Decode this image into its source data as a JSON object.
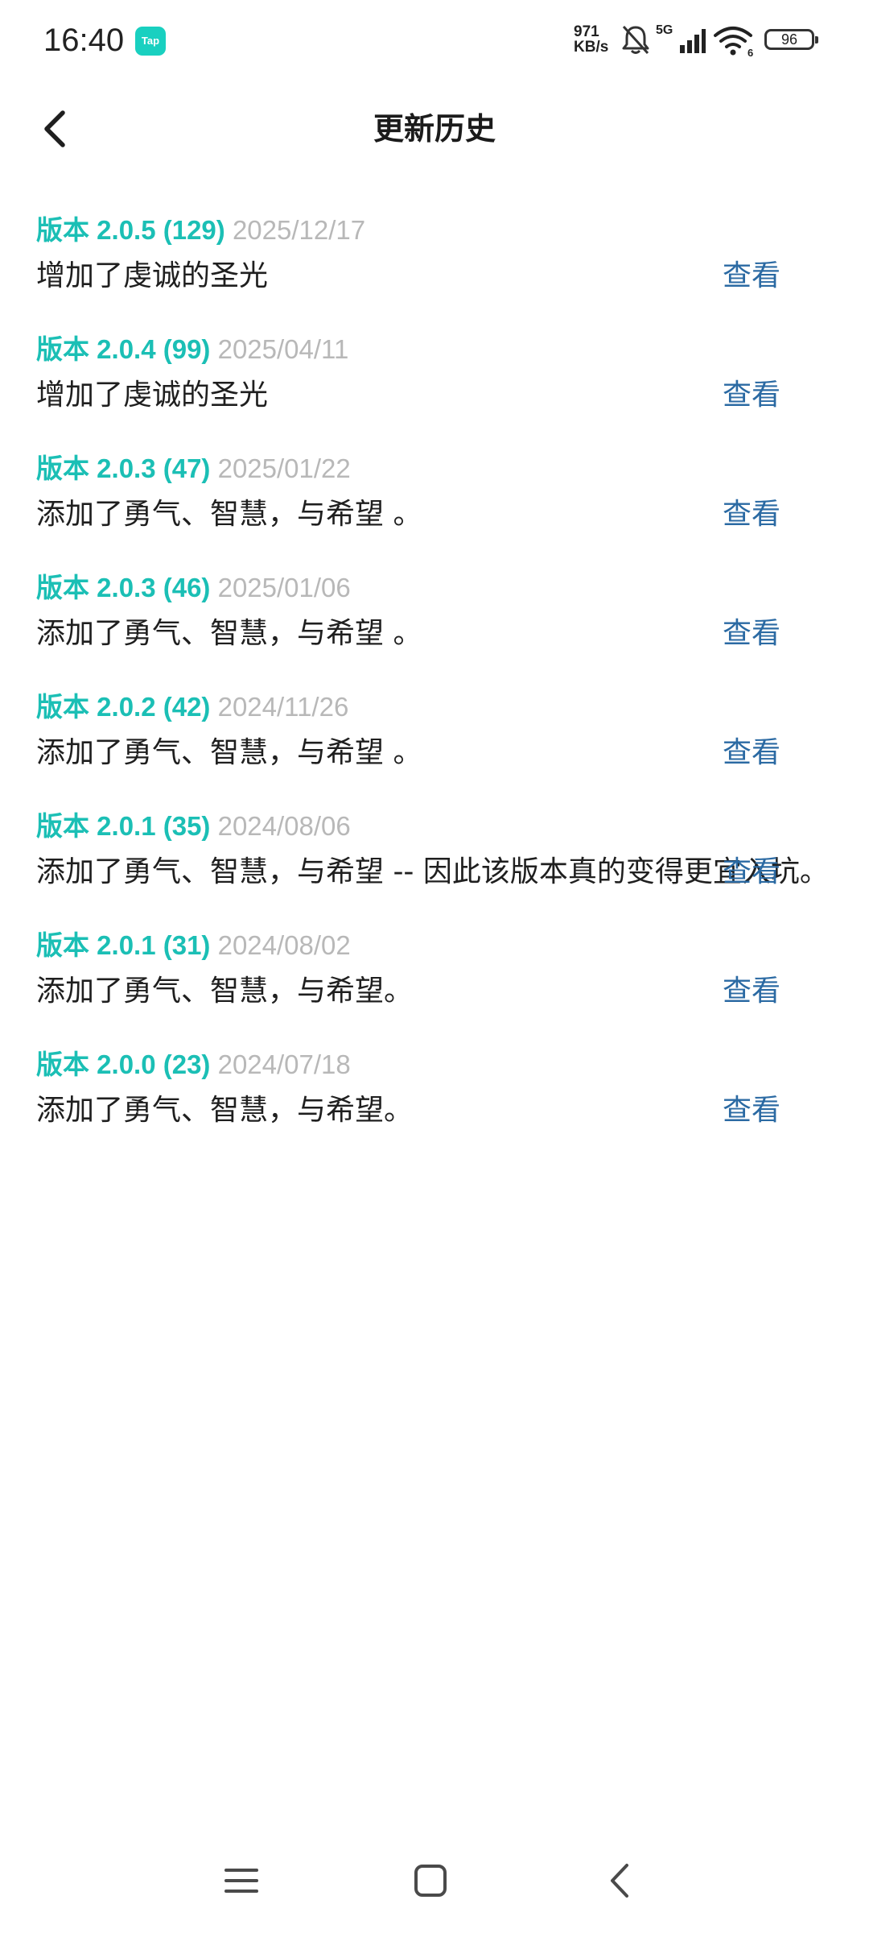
{
  "status_bar": {
    "time": "16:40",
    "app_badge": "Tap",
    "net_speed_value": "971",
    "net_speed_unit": "KB/s",
    "signal_label": "5G",
    "wifi_label": "6",
    "battery": "96"
  },
  "header": {
    "title": "更新历史"
  },
  "view_label": "查看",
  "entries": [
    {
      "version": "版本 2.0.5 (129)",
      "date": "2025/12/17",
      "text": "增加了虔诚的圣光"
    },
    {
      "version": "版本 2.0.4 (99)",
      "date": "2025/04/11",
      "text": "增加了虔诚的圣光"
    },
    {
      "version": "版本 2.0.3 (47)",
      "date": "2025/01/22",
      "text": "添加了勇气、智慧，与希望 。"
    },
    {
      "version": "版本 2.0.3 (46)",
      "date": "2025/01/06",
      "text": "添加了勇气、智慧，与希望 。"
    },
    {
      "version": "版本 2.0.2 (42)",
      "date": "2024/11/26",
      "text": "添加了勇气、智慧，与希望 。"
    },
    {
      "version": "版本 2.0.1 (35)",
      "date": "2024/08/06",
      "text": "添加了勇气、智慧，与希望 -- 因此该版本真的变得更宜入坑。"
    },
    {
      "version": "版本 2.0.1 (31)",
      "date": "2024/08/02",
      "text": "添加了勇气、智慧，与希望。"
    },
    {
      "version": "版本 2.0.0 (23)",
      "date": "2024/07/18",
      "text": "添加了勇气、智慧，与希望。"
    }
  ],
  "bottom_nav": {
    "items": [
      "menu-icon",
      "home-icon",
      "back-icon"
    ]
  }
}
